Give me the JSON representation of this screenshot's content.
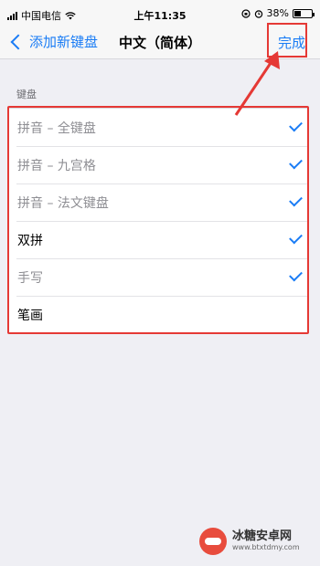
{
  "status_bar": {
    "carrier": "中国电信",
    "time": "上午11:35",
    "battery": "38%",
    "battery_level": 0.38
  },
  "nav": {
    "back_label": "添加新键盘",
    "title": "中文（简体）",
    "done_label": "完成"
  },
  "section_header": "键盘",
  "keyboards": [
    {
      "label": "拼音 – 全键盘",
      "checked": true,
      "dimmed": true
    },
    {
      "label": "拼音 – 九宫格",
      "checked": true,
      "dimmed": true
    },
    {
      "label": "拼音 – 法文键盘",
      "checked": true,
      "dimmed": true
    },
    {
      "label": "双拼",
      "checked": true,
      "dimmed": false
    },
    {
      "label": "手写",
      "checked": true,
      "dimmed": true
    },
    {
      "label": "笔画",
      "checked": false,
      "dimmed": false
    }
  ],
  "watermark": {
    "name": "冰糖安卓网",
    "url": "www.btxtdmy.com"
  },
  "colors": {
    "accent": "#1a7cf5",
    "annotation": "#e53935",
    "background": "#efeff4"
  }
}
